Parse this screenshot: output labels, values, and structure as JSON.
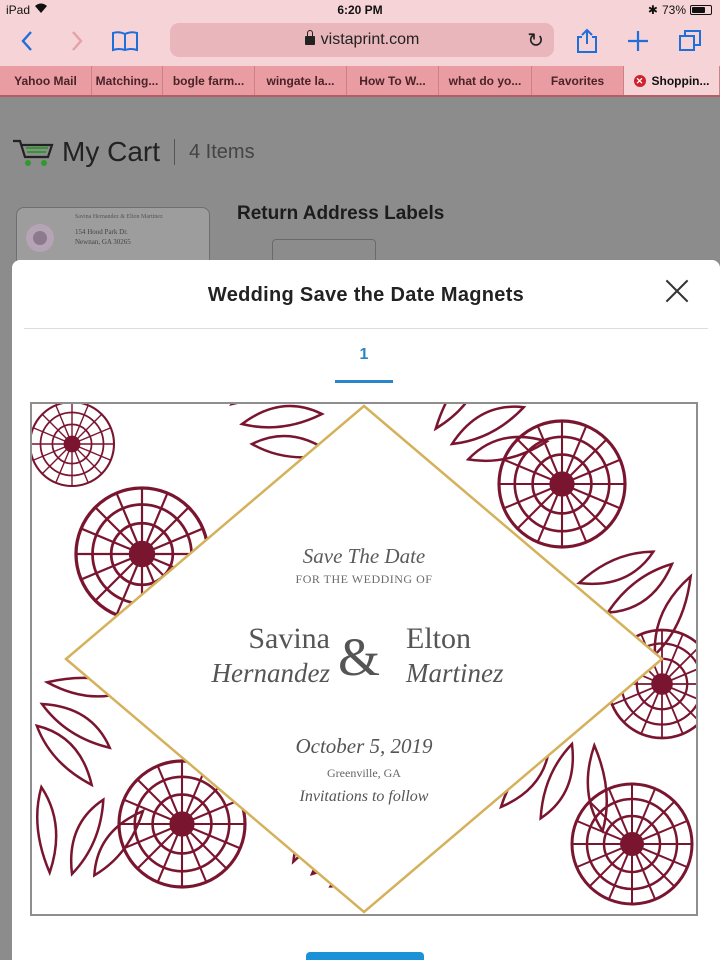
{
  "status": {
    "device": "iPad",
    "time": "6:20 PM",
    "battery": "73%",
    "battery_level": 0.73
  },
  "browser": {
    "url": "vistaprint.com",
    "icons": [
      "back-icon",
      "forward-icon",
      "bookmarks-icon",
      "lock-icon",
      "reload-icon",
      "share-icon",
      "new-tab-icon",
      "tabs-icon"
    ],
    "tabs": [
      {
        "label": "Yahoo Mail"
      },
      {
        "label": "Matching..."
      },
      {
        "label": "bogle farm..."
      },
      {
        "label": "wingate la..."
      },
      {
        "label": "How To W..."
      },
      {
        "label": "what do yo..."
      },
      {
        "label": "Favorites"
      },
      {
        "label": "Shoppin..."
      }
    ]
  },
  "cart": {
    "title": "My Cart",
    "count": "4 Items",
    "item_name": "Return Address Labels",
    "thumb_line1": "Savina Hernandez & Elton Martinez",
    "thumb_line2": "154 Hood Park Dr.",
    "thumb_line3": "Newnan, GA 30265"
  },
  "modal": {
    "title": "Wedding Save the Date Magnets",
    "page_tab": "1",
    "card": {
      "save": "Save The Date",
      "for": "FOR THE WEDDING OF",
      "first1": "Savina",
      "last1": "Hernandez",
      "amp": "&",
      "first2": "Elton",
      "last2": "Martinez",
      "date": "October 5, 2019",
      "location": "Greenville, GA",
      "invites": "Invitations to follow"
    }
  },
  "colors": {
    "accent": "#1b92d8",
    "floral": "#7a1530",
    "gold": "#d4b15a",
    "toolbar": "#f6d3d6"
  }
}
